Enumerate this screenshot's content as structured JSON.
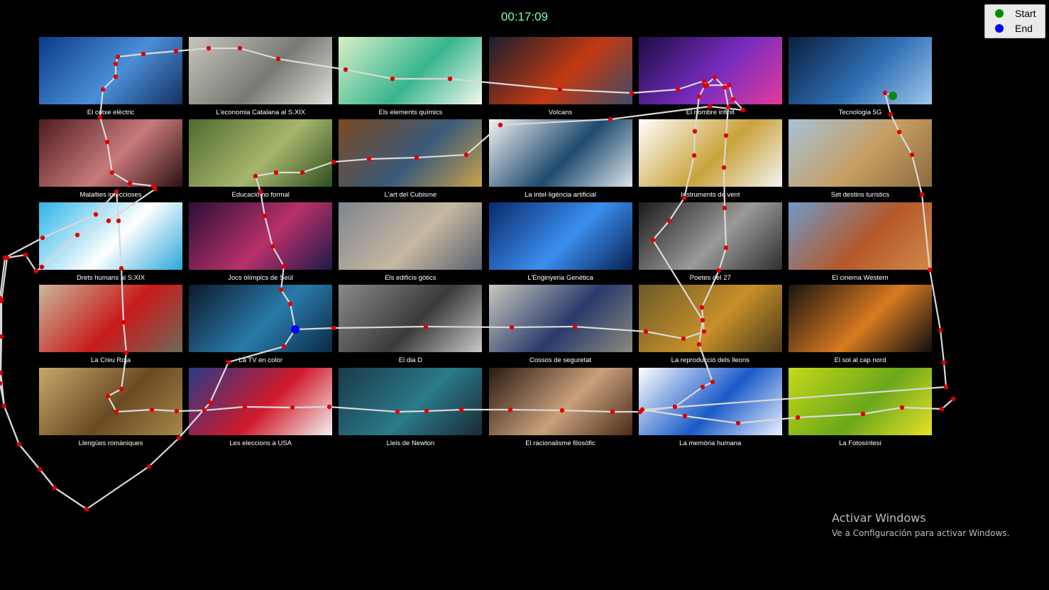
{
  "timer": "00:17:09",
  "legend": {
    "start_label": "Start",
    "end_label": "End",
    "start_color": "#0a8a0a",
    "end_color": "#0000ff",
    "point_color": "#e00000",
    "path_color": "#d9d9d9"
  },
  "tiles": [
    {
      "label": "El cotxe elèctric",
      "colors": [
        "#0d3a8a",
        "#4a8fd8",
        "#163060"
      ]
    },
    {
      "label": "L'economia Catalana al S.XIX",
      "colors": [
        "#c9c6be",
        "#777a74",
        "#e2e0dc"
      ]
    },
    {
      "label": "Els elements químics",
      "colors": [
        "#d9f0c8",
        "#38b58e",
        "#f5f8f0"
      ]
    },
    {
      "label": "Volcans",
      "colors": [
        "#1a1e2e",
        "#c23a12",
        "#3e4a66"
      ]
    },
    {
      "label": "El nombre infinit",
      "colors": [
        "#1b0e46",
        "#7a2cc0",
        "#e23b9a"
      ]
    },
    {
      "label": "Tecnologia 5G",
      "colors": [
        "#0c1e3c",
        "#2f6fb5",
        "#9fc7ea"
      ]
    },
    {
      "label": "Malalties infeccioses",
      "colors": [
        "#4d1c20",
        "#c97a7a",
        "#2e1014"
      ]
    },
    {
      "label": "Educació no formal",
      "colors": [
        "#4f6a2e",
        "#a7b66c",
        "#2f4f22"
      ]
    },
    {
      "label": "L'art del Cubisme",
      "colors": [
        "#7a4a22",
        "#3b5a7a",
        "#c9a24a"
      ]
    },
    {
      "label": "La intel·ligència artificial",
      "colors": [
        "#f2f2f2",
        "#1d4a6e",
        "#dfe6ec"
      ]
    },
    {
      "label": "Instruments de vent",
      "colors": [
        "#ffffff",
        "#c9a23a",
        "#f4f4f4"
      ]
    },
    {
      "label": "Set destins turístics",
      "colors": [
        "#a7c2d8",
        "#c69d60",
        "#8a6a3e"
      ]
    },
    {
      "label": "Drets humans al S.XIX",
      "colors": [
        "#2db4e8",
        "#ffffff",
        "#2aa7da"
      ]
    },
    {
      "label": "Jocs olímpics de Seül",
      "colors": [
        "#2a1036",
        "#b8306a",
        "#1e1a4a"
      ]
    },
    {
      "label": "Els edificis gòtics",
      "colors": [
        "#7d8591",
        "#c7b8a0",
        "#5a6170"
      ]
    },
    {
      "label": "L'Enginyeria Genètica",
      "colors": [
        "#0a2a6a",
        "#3b8ff0",
        "#072052"
      ]
    },
    {
      "label": "Poetes del 27",
      "colors": [
        "#1a1a1a",
        "#9a9a9a",
        "#2e2e2e"
      ]
    },
    {
      "label": "El cinema Western",
      "colors": [
        "#6e9ac9",
        "#b5582a",
        "#d28a4a"
      ]
    },
    {
      "label": "La Creu Roja",
      "colors": [
        "#c8b89a",
        "#c81a1a",
        "#6e6a5a"
      ]
    },
    {
      "label": "La TV en color",
      "colors": [
        "#0c1a2a",
        "#2a7aaa",
        "#0a2a44"
      ]
    },
    {
      "label": "El dia D",
      "colors": [
        "#8a8a8a",
        "#3a3a3a",
        "#c8c8c8"
      ]
    },
    {
      "label": "Cossos de seguretat",
      "colors": [
        "#c8c8c0",
        "#2a3a6a",
        "#8a8a80"
      ]
    },
    {
      "label": "La reproducció dels lleons",
      "colors": [
        "#6a5a2a",
        "#c8902a",
        "#4a3a1a"
      ]
    },
    {
      "label": "El sol al cap nord",
      "colors": [
        "#1a1410",
        "#d87a20",
        "#0e0e12"
      ]
    },
    {
      "label": "Llengües romàniques",
      "colors": [
        "#c8a86a",
        "#6a4a22",
        "#a8884a"
      ]
    },
    {
      "label": "Les eleccions a USA",
      "colors": [
        "#2a3a8a",
        "#d01a2a",
        "#f2f2f2"
      ]
    },
    {
      "label": "Lleis de Newton",
      "colors": [
        "#1a3a4a",
        "#2a7a8a",
        "#1a2a34"
      ]
    },
    {
      "label": "El racionalisme filosòfic",
      "colors": [
        "#2a1a12",
        "#c8a07a",
        "#4a2a1a"
      ]
    },
    {
      "label": "La memòria humana",
      "colors": [
        "#ffffff",
        "#1a5ac8",
        "#eaf2ff"
      ]
    },
    {
      "label": "La Fotosíntesi",
      "colors": [
        "#c8d81a",
        "#6aa81a",
        "#e8e02a"
      ]
    }
  ],
  "gaze_path": [
    [
      6,
      78
    ],
    [
      4,
      60
    ],
    [
      2,
      45
    ],
    [
      2,
      35
    ],
    [
      3,
      28
    ],
    [
      4,
      26
    ],
    [
      5,
      23
    ],
    [
      6,
      22
    ],
    [
      10,
      20
    ],
    [
      15,
      16
    ],
    [
      18,
      15
    ],
    [
      20,
      14
    ],
    [
      24,
      13
    ],
    [
      27,
      12
    ],
    [
      28,
      11
    ],
    [
      29,
      10
    ],
    [
      33,
      9
    ],
    [
      37,
      8
    ],
    [
      41,
      6
    ],
    [
      44,
      4
    ],
    [
      45,
      2
    ],
    [
      46,
      1
    ],
    [
      48,
      0
    ],
    [
      50,
      -0.5
    ],
    [
      51,
      0
    ],
    [
      52,
      -1
    ],
    [
      54,
      0.5
    ],
    [
      56,
      0
    ],
    [
      60,
      1
    ],
    [
      63,
      0.5
    ],
    [
      67,
      1
    ],
    [
      70,
      1
    ],
    [
      75,
      0.3
    ],
    [
      80,
      1
    ],
    [
      84,
      2
    ],
    [
      86,
      3
    ],
    [
      88,
      5
    ],
    [
      90,
      7
    ],
    [
      91,
      9
    ],
    [
      93,
      11
    ],
    [
      95,
      13
    ],
    [
      97,
      17
    ],
    [
      99,
      20
    ],
    [
      101,
      25
    ],
    [
      102,
      30
    ],
    [
      104,
      35
    ],
    [
      106,
      40
    ],
    [
      108,
      45
    ],
    [
      110,
      52
    ],
    [
      113,
      57
    ],
    [
      116,
      60
    ],
    [
      117,
      62
    ],
    [
      118,
      64
    ],
    [
      119,
      66
    ]
  ],
  "watermark": {
    "line1": "Activar Windows",
    "line2": "Ve a Configuración para activar Windows."
  }
}
